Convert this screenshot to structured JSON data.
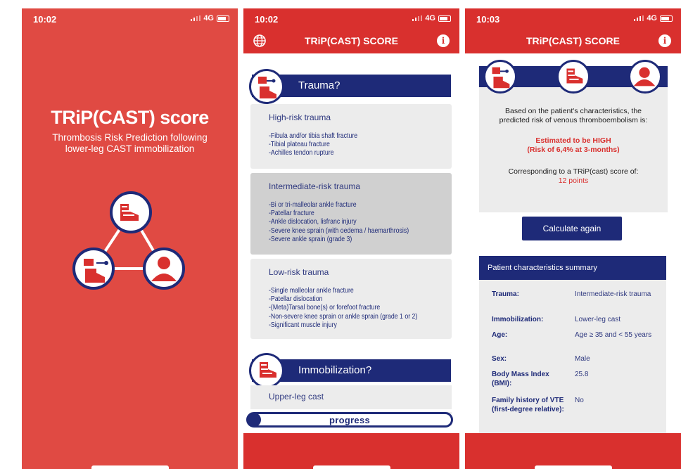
{
  "screen1": {
    "time": "10:02",
    "network": "4G",
    "title": "TRiP(CAST) score",
    "subtitle1": "Thrombosis Risk Prediction following",
    "subtitle2": "lower-leg CAST immobilization"
  },
  "screen2": {
    "time": "10:02",
    "network": "4G",
    "nav_title": "TRiP(CAST) SCORE",
    "trauma_header": "Trauma?",
    "high": {
      "title": "High-risk trauma",
      "items": [
        "-Fibula and/or tibia shaft fracture",
        "-Tibial plateau fracture",
        "-Achilles tendon rupture"
      ]
    },
    "intermediate": {
      "title": "Intermediate-risk trauma",
      "items": [
        "-Bi or tri-malleolar ankle fracture",
        "-Patellar fracture",
        "-Ankle dislocation, lisfranc injury",
        "-Severe knee sprain (with oedema / haemarthrosis)",
        "-Severe ankle sprain (grade 3)"
      ]
    },
    "low": {
      "title": "Low-risk trauma",
      "items": [
        "-Single malleolar ankle fracture",
        "-Patellar dislocation",
        "-(Meta)Tarsal bone(s) or forefoot fracture",
        "-Non-severe knee sprain or ankle sprain (grade 1 or 2)",
        "-Significant muscle injury"
      ]
    },
    "immobilization_header": "Immobilization?",
    "option1": "Upper-leg cast",
    "progress_label": "progress",
    "progress_value": 0.02
  },
  "screen3": {
    "time": "10:03",
    "network": "4G",
    "nav_title": "TRiP(CAST) SCORE",
    "result_line1": "Based on the patient's characteristics, the",
    "result_line2": "predicted risk of venous thromboembolism is:",
    "estimate_line1": "Estimated to be HIGH",
    "estimate_line2": "(Risk of 6,4% at 3-months)",
    "score_line": "Corresponding to a TRiP(cast) score of:",
    "points": "12 points",
    "calc_button": "Calculate again",
    "summary_title": "Patient characteristics summary",
    "summary": [
      {
        "k": "Trauma:",
        "v": "Intermediate-risk trauma"
      },
      {
        "k": "Immobilization:",
        "v": "Lower-leg cast"
      },
      {
        "k": "Age:",
        "v": "Age ≥ 35 and < 55 years"
      },
      {
        "k": "Sex:",
        "v": "Male"
      },
      {
        "k": "Body Mass Index (BMI):",
        "v": "25.8"
      },
      {
        "k": "Family history of VTE (first-degree relative):",
        "v": "No"
      }
    ]
  },
  "colors": {
    "red": "#d9302e",
    "splash_red": "#e04a43",
    "navy": "#1e2a78",
    "card": "#ececec",
    "card_selected": "#d0d0d0"
  }
}
